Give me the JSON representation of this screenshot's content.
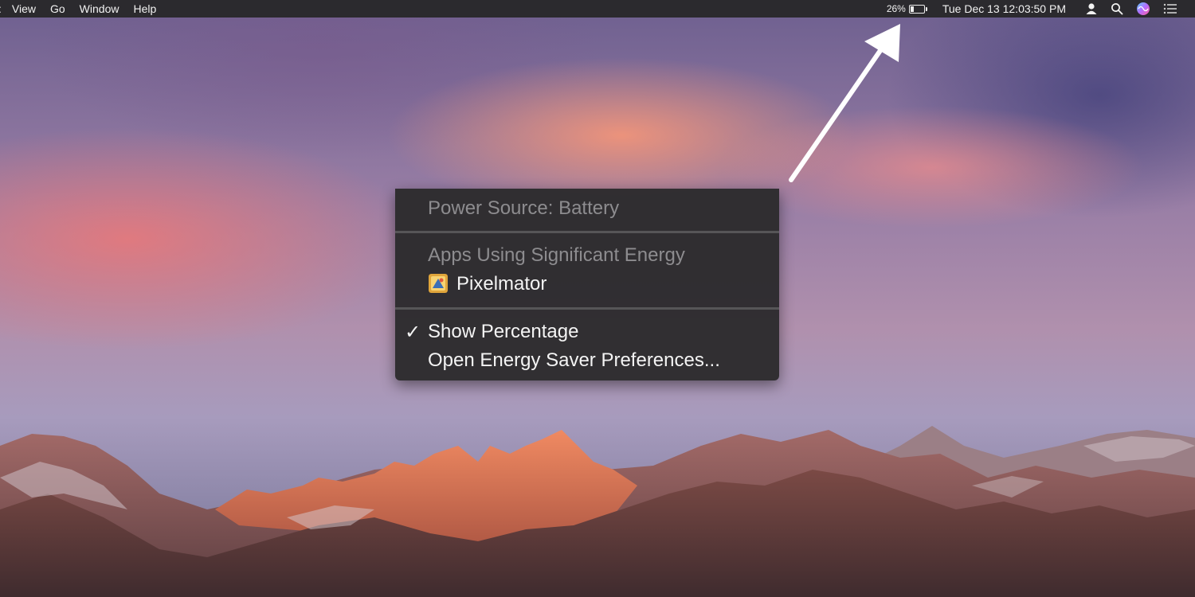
{
  "menubar": {
    "apple_fragment": ":",
    "menus": [
      "View",
      "Go",
      "Window",
      "Help"
    ],
    "battery_percent": "26%",
    "battery_level": 0.26,
    "clock": "Tue Dec 13  12:03:50 PM",
    "icons": [
      "battery-icon",
      "user-icon",
      "spotlight-search-icon",
      "siri-icon",
      "notification-center-icon"
    ]
  },
  "battery_menu": {
    "power_source": "Power Source: Battery",
    "apps_heading": "Apps Using Significant Energy",
    "app_name": "Pixelmator",
    "show_percentage": "Show Percentage",
    "show_percentage_checked": true,
    "checkmark": "✓",
    "open_prefs": "Open Energy Saver Preferences..."
  },
  "colors": {
    "menubar_bg": "#2b2a2e",
    "menu_bg": "#2c2b2d",
    "disabled_text": "#8d8c8f",
    "arrow": "#ffffff"
  }
}
